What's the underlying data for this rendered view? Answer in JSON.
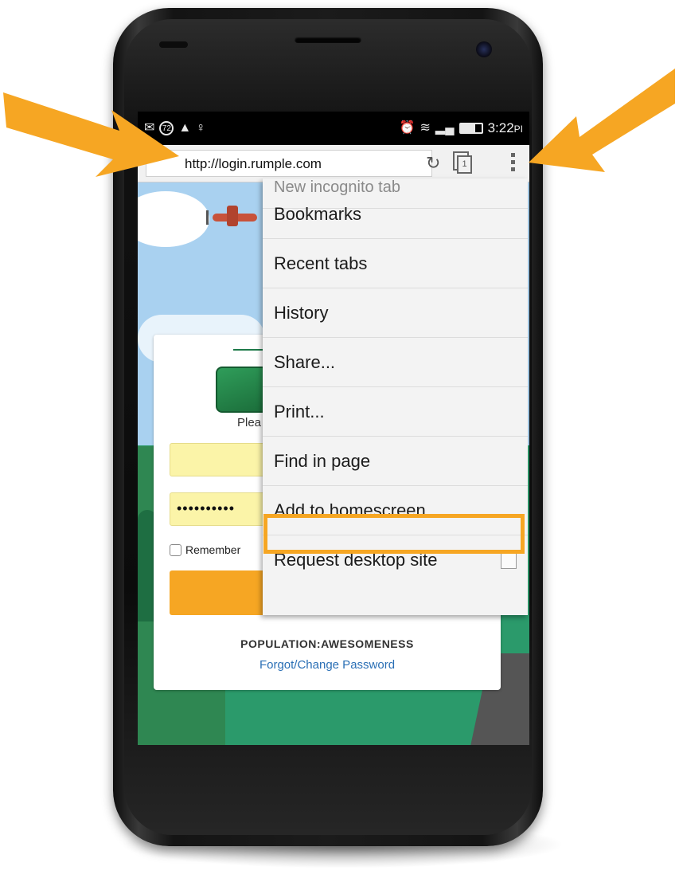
{
  "status_bar": {
    "notification_badge": "72",
    "time": "3:22",
    "time_suffix_partial": "PI"
  },
  "browser": {
    "url": "http://login.rumple.com",
    "tab_count": "1"
  },
  "overflow_menu": {
    "items": [
      {
        "label": "New incognito tab"
      },
      {
        "label": "Bookmarks"
      },
      {
        "label": "Recent tabs"
      },
      {
        "label": "History"
      },
      {
        "label": "Share..."
      },
      {
        "label": "Print..."
      },
      {
        "label": "Find in page"
      },
      {
        "label": "Add to homescreen"
      },
      {
        "label": "Request desktop site"
      }
    ],
    "highlighted_item": "Add to homescreen"
  },
  "login_page": {
    "please_text_partial": "Plea",
    "password_mask": "••••••••••",
    "remember_label_partial": "Remember",
    "tagline": "POPULATION:AWESOMENESS",
    "forgot_link": "Forgot/Change Password"
  },
  "colors": {
    "annotation_arrow": "#f6a623",
    "highlight_box": "#f6a623",
    "login_button": "#f6a623",
    "field_background": "#fbf4a8",
    "page_green": "#2b9a6b",
    "link_blue": "#2a6fb5"
  }
}
